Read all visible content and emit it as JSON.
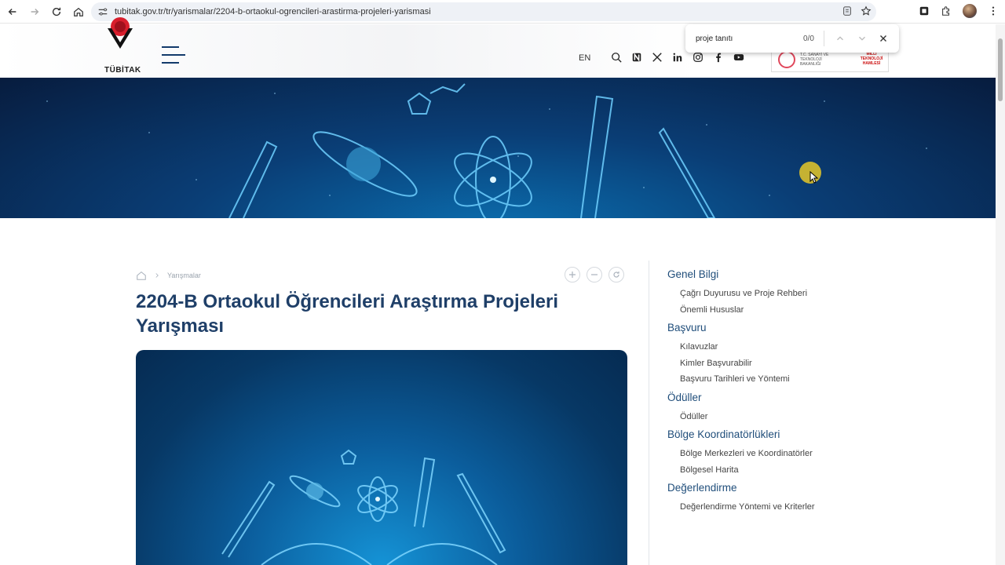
{
  "browser": {
    "url": "tubitak.gov.tr/tr/yarismalar/2204-b-ortaokul-ogrencileri-arastirma-projeleri-yarismasi"
  },
  "find_bar": {
    "query": "proje tanıtı",
    "count": "0/0"
  },
  "header": {
    "logo_text": "TÜBİTAK",
    "lang": "EN",
    "ministry_text": "T.C. SANAYİ VE TEKNOLOJİ BAKANLIĞI",
    "ministry_text2": "MİLLİ TEKNOLOJİ HAMLESİ"
  },
  "breadcrumb": {
    "current": "Yarışmalar"
  },
  "page": {
    "title": "2204-B Ortaokul Öğrencileri Araştırma Projeleri Yarışması"
  },
  "sidenav": {
    "sections": [
      {
        "title": "Genel Bilgi",
        "items": [
          "Çağrı Duyurusu ve Proje Rehberi",
          "Önemli Hususlar"
        ]
      },
      {
        "title": "Başvuru",
        "items": [
          "Kılavuzlar",
          "Kimler Başvurabilir",
          "Başvuru Tarihleri ve Yöntemi"
        ]
      },
      {
        "title": "Ödüller",
        "items": [
          "Ödüller"
        ]
      },
      {
        "title": "Bölge Koordinatörlükleri",
        "items": [
          "Bölge Merkezleri ve Koordinatörler",
          "Bölgesel Harita"
        ]
      },
      {
        "title": "Değerlendirme",
        "items": [
          "Değerlendirme Yöntemi ve Kriterler"
        ]
      }
    ]
  },
  "colors": {
    "title_blue": "#1f3f68",
    "nav_blue": "#1f4d7a",
    "hero_dark": "#071c3e"
  }
}
